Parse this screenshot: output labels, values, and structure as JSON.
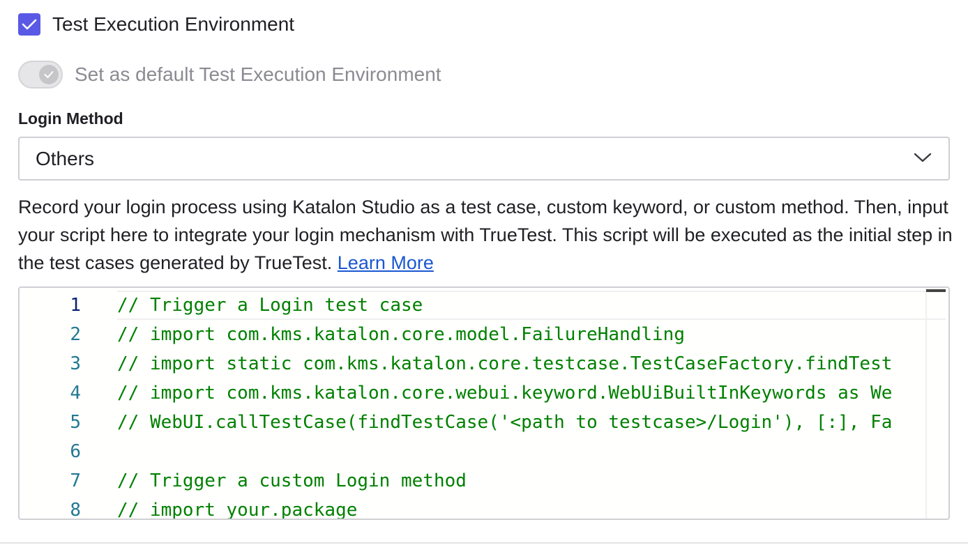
{
  "environment": {
    "checkbox_label": "Test Execution Environment",
    "checked": true,
    "default_toggle_label": "Set as default Test Execution Environment"
  },
  "login_method": {
    "label": "Login Method",
    "selected": "Others"
  },
  "description": {
    "text": "Record your login process using Katalon Studio as a test case, custom keyword, or custom method. Then, input your script here to integrate your login mechanism with TrueTest. This script will be executed as the initial step in the test cases generated by TrueTest.",
    "link_label": "Learn More"
  },
  "editor": {
    "lines": [
      {
        "num": "1",
        "code": "// Trigger a Login test case"
      },
      {
        "num": "2",
        "code": "// import com.kms.katalon.core.model.FailureHandling"
      },
      {
        "num": "3",
        "code": "// import static com.kms.katalon.core.testcase.TestCaseFactory.findTest"
      },
      {
        "num": "4",
        "code": "// import com.kms.katalon.core.webui.keyword.WebUiBuiltInKeywords as We"
      },
      {
        "num": "5",
        "code": "// WebUI.callTestCase(findTestCase('<path to testcase>/Login'), [:], Fa"
      },
      {
        "num": "6",
        "code": ""
      },
      {
        "num": "7",
        "code": "// Trigger a custom Login method"
      },
      {
        "num": "8",
        "code": "// import your.package"
      }
    ]
  },
  "colors": {
    "accent": "#5959e6",
    "comment": "#008000",
    "line_number": "#237893",
    "link": "#1a57d1"
  },
  "icons": {
    "checkbox": "check-icon",
    "toggle": "check-icon",
    "select": "chevron-down-icon"
  }
}
